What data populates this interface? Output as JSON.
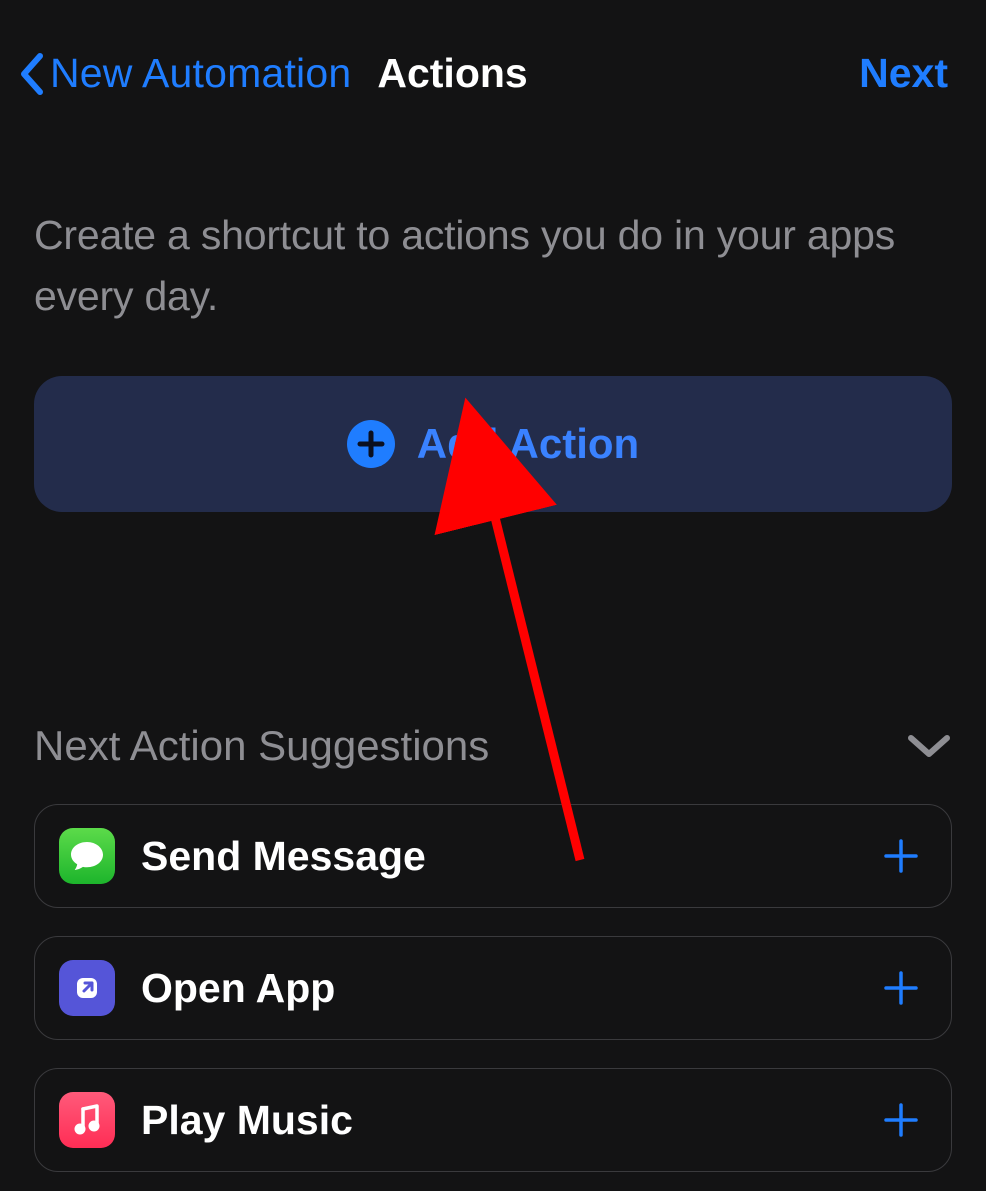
{
  "nav": {
    "back_label": "New Automation",
    "title": "Actions",
    "next_label": "Next"
  },
  "description": "Create a shortcut to actions you do in your apps every day.",
  "add_action_label": "Add Action",
  "suggestions": {
    "header": "Next Action Suggestions",
    "items": [
      {
        "label": "Send Message",
        "icon": "messages"
      },
      {
        "label": "Open App",
        "icon": "open-app"
      },
      {
        "label": "Play Music",
        "icon": "music"
      }
    ]
  },
  "colors": {
    "accent": "#1f7dff",
    "add_action_bg": "#232c4b",
    "row_border": "#3a3a3d"
  }
}
